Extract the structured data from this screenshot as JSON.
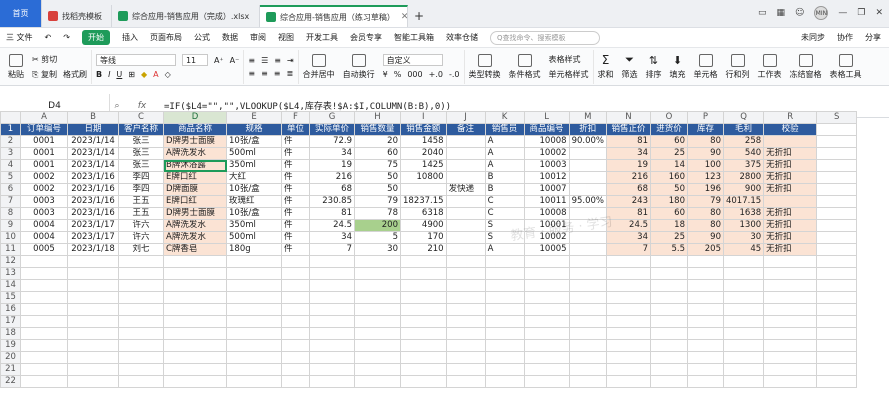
{
  "tabs": [
    {
      "label": "首页",
      "type": "home"
    },
    {
      "label": "找稻壳模板",
      "color": "#d8413c"
    },
    {
      "label": "综合应用-销售应用（完成）.xlsx",
      "color": "#1e9b5a"
    },
    {
      "label": "综合应用-销售应用（练习草稿）",
      "color": "#1e9b5a",
      "active": true
    }
  ],
  "new_tab": "+",
  "window": {
    "avatar": "MIN"
  },
  "menu": {
    "file": "三 文件",
    "start": "开始",
    "items": [
      "插入",
      "页面布局",
      "公式",
      "数据",
      "审阅",
      "视图",
      "开发工具",
      "会员专享",
      "智能工具箱",
      "效率仓储"
    ],
    "search": "Q查找命令、搜索模板",
    "sync": "未同步",
    "collab": "协作",
    "share": "分享"
  },
  "toolbar": {
    "cut": "剪切",
    "paste": "粘贴",
    "copy": "复制",
    "format_painter": "格式刷",
    "font_name": "等线",
    "font_size": "11",
    "merge": "合并居中",
    "wrap": "自动换行",
    "number_format": "自定义",
    "type_convert": "类型转换",
    "cond_format": "条件格式",
    "table_style": "表格样式",
    "cell_style": "单元格样式",
    "sum": "求和",
    "filter": "筛选",
    "sort": "排序",
    "fill": "填充",
    "cell": "单元格",
    "rowcol": "行和列",
    "worksheet": "工作表",
    "freeze": "冻结窗格",
    "tools": "表格工具"
  },
  "formula_bar": {
    "cell": "D4",
    "fx": "fx",
    "formula": "=IF($L4=\"\",\"\",VLOOKUP($L4,库存表!$A:$I,COLUMN(B:B),0))"
  },
  "columns": [
    "",
    "A",
    "B",
    "C",
    "D",
    "E",
    "F",
    "G",
    "H",
    "I",
    "J",
    "K",
    "L",
    "M",
    "N",
    "O",
    "P",
    "Q",
    "R",
    "S"
  ],
  "headers": [
    "订单编号",
    "日期",
    "客户名称",
    "商品名称",
    "规格",
    "单位",
    "实际单价",
    "销售数量",
    "销售金额",
    "备注",
    "销售员",
    "商品编号",
    "折扣",
    "销售正价",
    "进货价",
    "库存",
    "毛利",
    "校验",
    ""
  ],
  "rows": [
    [
      "0001",
      "2023/1/14",
      "张三",
      "D牌男士面膜",
      "10张/盒",
      "件",
      "72.9",
      "20",
      "1458",
      "",
      "A",
      "10008",
      "90.00%",
      "81",
      "60",
      "80",
      "258",
      ""
    ],
    [
      "0001",
      "2023/1/14",
      "张三",
      "A牌洗发水",
      "500ml",
      "件",
      "34",
      "60",
      "2040",
      "",
      "A",
      "10002",
      "",
      "34",
      "25",
      "90",
      "540",
      "无折扣"
    ],
    [
      "0001",
      "2023/1/14",
      "张三",
      "B牌沐浴露",
      "350ml",
      "件",
      "19",
      "75",
      "1425",
      "",
      "A",
      "10003",
      "",
      "19",
      "14",
      "100",
      "375",
      "无折扣"
    ],
    [
      "0002",
      "2023/1/16",
      "李四",
      "E牌口红",
      "大红",
      "件",
      "216",
      "50",
      "10800",
      "",
      "B",
      "10012",
      "",
      "216",
      "160",
      "123",
      "2800",
      "无折扣"
    ],
    [
      "0002",
      "2023/1/16",
      "李四",
      "D牌面膜",
      "10张/盒",
      "件",
      "68",
      "50",
      "",
      "发快递",
      "B",
      "10007",
      "",
      "68",
      "50",
      "196",
      "900",
      "无折扣"
    ],
    [
      "0003",
      "2023/1/16",
      "王五",
      "E牌口红",
      "玫瑰红",
      "件",
      "230.85",
      "79",
      "18237.15",
      "",
      "C",
      "10011",
      "95.00%",
      "243",
      "180",
      "79",
      "4017.15",
      ""
    ],
    [
      "0003",
      "2023/1/16",
      "王五",
      "D牌男士面膜",
      "10张/盒",
      "件",
      "81",
      "78",
      "6318",
      "",
      "C",
      "10008",
      "",
      "81",
      "60",
      "80",
      "1638",
      "无折扣"
    ],
    [
      "0004",
      "2023/1/17",
      "许六",
      "A牌洗发水",
      "350ml",
      "件",
      "24.5",
      "200",
      "4900",
      "",
      "S",
      "10001",
      "",
      "24.5",
      "18",
      "80",
      "1300",
      "无折扣"
    ],
    [
      "0004",
      "2023/1/17",
      "许六",
      "A牌洗发水",
      "500ml",
      "件",
      "34",
      "5",
      "170",
      "",
      "S",
      "10002",
      "",
      "34",
      "25",
      "90",
      "30",
      "无折扣"
    ],
    [
      "0005",
      "2023/1/18",
      "刘七",
      "C牌香皂",
      "180g",
      "件",
      "7",
      "30",
      "210",
      "",
      "A",
      "10005",
      "",
      "7",
      "5.5",
      "205",
      "45",
      "无折扣"
    ]
  ],
  "empty_rows": [
    "12",
    "13",
    "14",
    "15",
    "16",
    "17",
    "18",
    "19",
    "20",
    "21",
    "22"
  ],
  "watermark": "教育 · 服务 · 学习"
}
